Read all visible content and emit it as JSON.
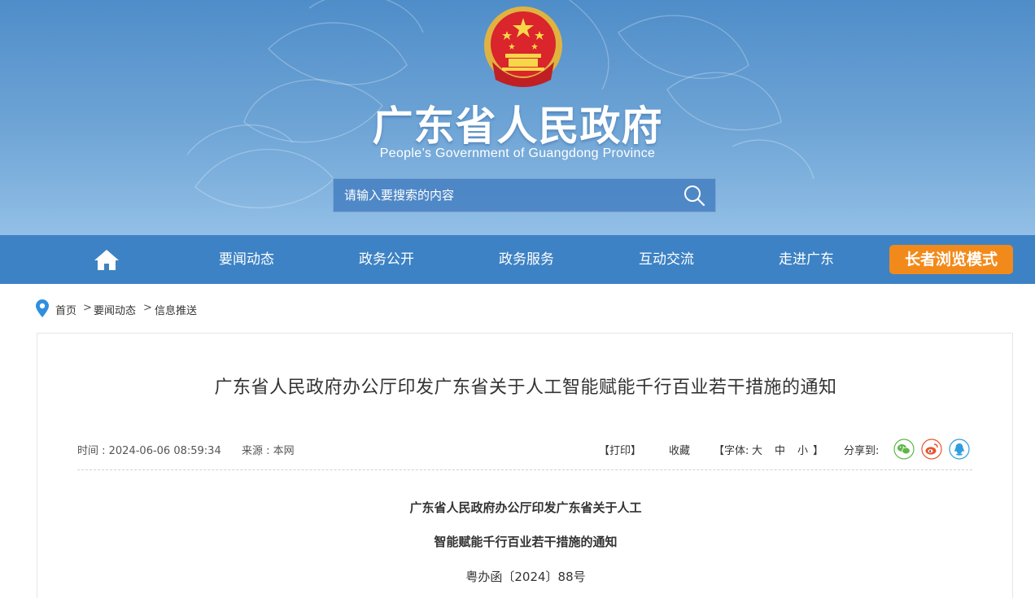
{
  "header": {
    "title": "广东省人民政府",
    "subtitle": "People’s Government of Guangdong Province",
    "emblem_icon": "national-emblem-icon",
    "search": {
      "placeholder": "请输入要搜索的内容",
      "icon": "search-icon"
    }
  },
  "nav": {
    "home_icon": "home-icon",
    "items": [
      {
        "label": "要闻动态"
      },
      {
        "label": "政务公开"
      },
      {
        "label": "政务服务"
      },
      {
        "label": "互动交流"
      },
      {
        "label": "走进广东"
      }
    ],
    "elder_mode_label": "长者浏览模式"
  },
  "breadcrumb": {
    "icon": "location-pin-icon",
    "items": [
      "首页",
      "要闻动态",
      "信息推送"
    ],
    "separator": ">"
  },
  "article": {
    "title": "广东省人民政府办公厅印发广东省关于人工智能赋能千行百业若干措施的通知",
    "meta": {
      "time": "时间 : 2024-06-06 08:59:34",
      "source": "来源 : 本网"
    },
    "tools": {
      "print": "【打印】",
      "favorite": "收藏",
      "font_prefix": "【字体:",
      "font_large": "大",
      "font_medium": "中",
      "font_small": "小",
      "font_suffix": "】",
      "share_label": "分享到:"
    },
    "share_icons": [
      "wechat-icon",
      "weibo-icon",
      "qq-icon"
    ],
    "body": {
      "heading_line1": "广东省人民政府办公厅印发广东省关于人工",
      "heading_line2": "智能赋能千行百业若干措施的通知",
      "doc_number": "粤办函〔2024〕88号"
    }
  },
  "colors": {
    "header_top": "#4f8dc9",
    "nav_bg": "#3d82c4",
    "elder_btn": "#f28a1b",
    "wechat": "#5fb548",
    "weibo": "#e8542a",
    "qq": "#2f9ee0"
  }
}
